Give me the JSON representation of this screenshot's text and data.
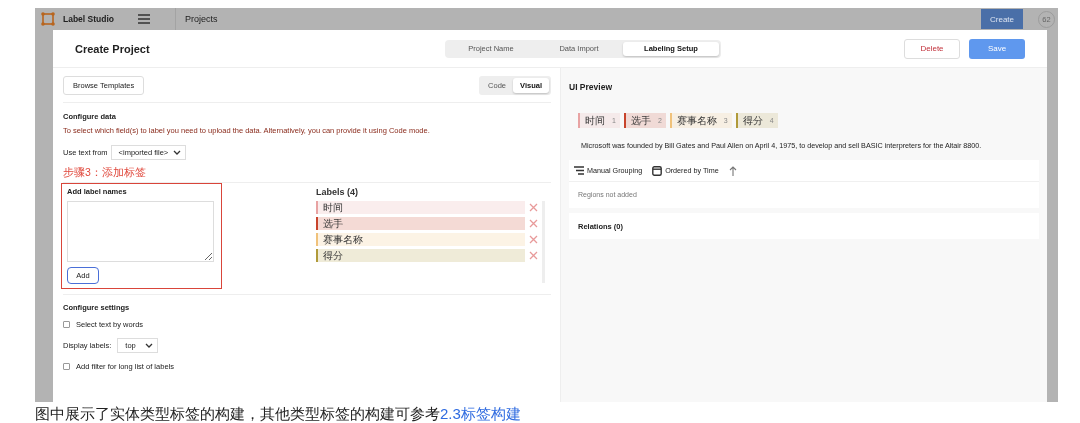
{
  "app": {
    "logo_text": "Label Studio",
    "breadcrumb": "Projects",
    "create_button": "Create",
    "avatar": "62"
  },
  "modal": {
    "title": "Create Project",
    "steps": [
      {
        "label": "Project Name",
        "selected": false
      },
      {
        "label": "Data Import",
        "selected": false
      },
      {
        "label": "Labeling Setup",
        "selected": true
      }
    ],
    "buttons": [
      {
        "label": "Delete",
        "kind": "delete"
      },
      {
        "label": "Save",
        "kind": "save"
      }
    ]
  },
  "editor": {
    "browse_templates": "Browse Templates",
    "mode_tabs": [
      {
        "label": "Code",
        "selected": false
      },
      {
        "label": "Visual",
        "selected": true
      }
    ],
    "configure_data": {
      "heading": "Configure data",
      "hint": "To select which field(s) to label you need to upload the data. Alternatively, you can provide it using Code mode.",
      "use_text_label": "Use text from",
      "use_text_value": "<imported file>"
    },
    "annotation": "步骤3：添加标签",
    "add_labels": {
      "heading": "Add label names",
      "button": "Add"
    },
    "labels": {
      "heading": "Labels (4)",
      "items": [
        {
          "name": "时间",
          "color": "#e8a3a3"
        },
        {
          "name": "选手",
          "color": "#c8442c"
        },
        {
          "name": "赛事名称",
          "color": "#f0c27b"
        },
        {
          "name": "得分",
          "color": "#b09a3a"
        }
      ]
    },
    "configure_settings": {
      "heading": "Configure settings",
      "options": [
        {
          "kind": "checkbox",
          "label": "Select text by words",
          "checked": false
        },
        {
          "kind": "select",
          "label": "Display labels:",
          "value": "top"
        },
        {
          "kind": "checkbox",
          "label": "Add filter for long list of labels",
          "checked": false
        }
      ]
    }
  },
  "preview": {
    "title": "UI Preview",
    "tags": [
      {
        "name": "时间",
        "hotkey": "1",
        "color": "#e8a3a3"
      },
      {
        "name": "选手",
        "hotkey": "2",
        "color": "#c8442c"
      },
      {
        "name": "赛事名称",
        "hotkey": "3",
        "color": "#f0c27b"
      },
      {
        "name": "得分",
        "hotkey": "4",
        "color": "#b09a3a"
      }
    ],
    "text": "Microsoft was founded by Bill Gates and Paul Allen on April 4, 1975, to develop and sell BASIC interpreters for the Altair 8800.",
    "grouping": "Manual Grouping",
    "ordering": "Ordered by Time",
    "regions_empty": "Regions not added",
    "relations": "Relations (0)"
  },
  "caption": {
    "text": "图中展示了实体类型标签的构建，其他类型标签的构建可参考",
    "link": "2.3标签构建"
  }
}
